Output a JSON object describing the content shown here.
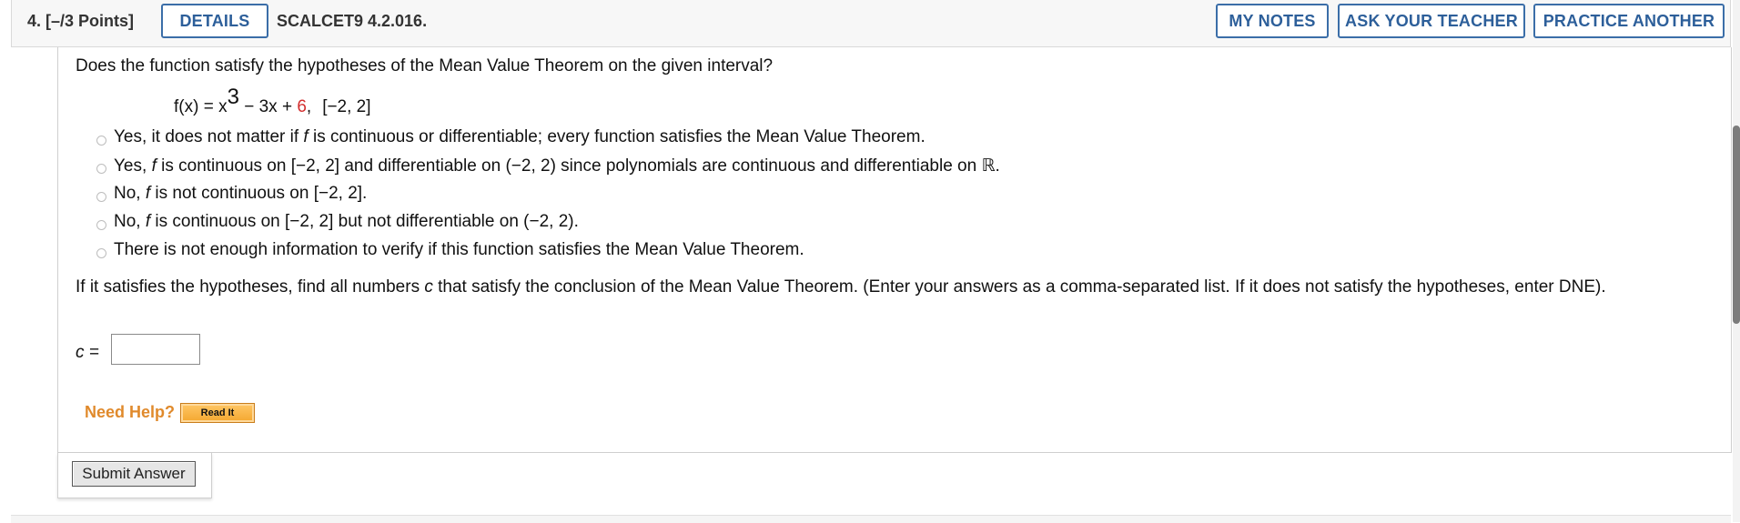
{
  "header": {
    "question_points": "4. [–/3 Points]",
    "details_label": "DETAILS",
    "course_code": "SCALCET9 4.2.016.",
    "my_notes_label": "MY NOTES",
    "ask_teacher_label": "ASK YOUR TEACHER",
    "practice_another_label": "PRACTICE ANOTHER"
  },
  "question": {
    "prompt": "Does the function satisfy the hypotheses of the Mean Value Theorem on the given interval?",
    "equation": {
      "lhs": "f(x) = x",
      "exponent": "3",
      "mid": " − 3x + ",
      "constant": "6",
      "sep": ",",
      "interval": "[−2, 2]"
    },
    "choices": [
      {
        "pre": "Yes, it does not matter if ",
        "post": " is continuous or differentiable; every function satisfies the Mean Value Theorem."
      },
      {
        "pre": "Yes, ",
        "post": " is continuous on [−2, 2] and differentiable on (−2, 2) since polynomials are continuous and differentiable on ℝ."
      },
      {
        "pre": "No, ",
        "post": " is not continuous on [−2, 2]."
      },
      {
        "pre": "No, ",
        "post": " is continuous on [−2, 2] but not differentiable on (−2, 2)."
      },
      {
        "text": "There is not enough information to verify if this function satisfies the Mean Value Theorem."
      }
    ],
    "var_f": "f",
    "followup_pre": "If it satisfies the hypotheses, find all numbers ",
    "followup_var": "c",
    "followup_post": " that satisfy the conclusion of the Mean Value Theorem. (Enter your answers as a comma-separated list. If it does not satisfy the hypotheses, enter DNE).",
    "answer_label": "c =",
    "answer_value": "",
    "need_help": "Need Help?",
    "read_it": "Read It"
  },
  "submit_label": "Submit Answer",
  "colors": {
    "accent_blue": "#2d5f9a",
    "red_constant": "#d32f2f",
    "help_orange": "#e08a2c"
  }
}
